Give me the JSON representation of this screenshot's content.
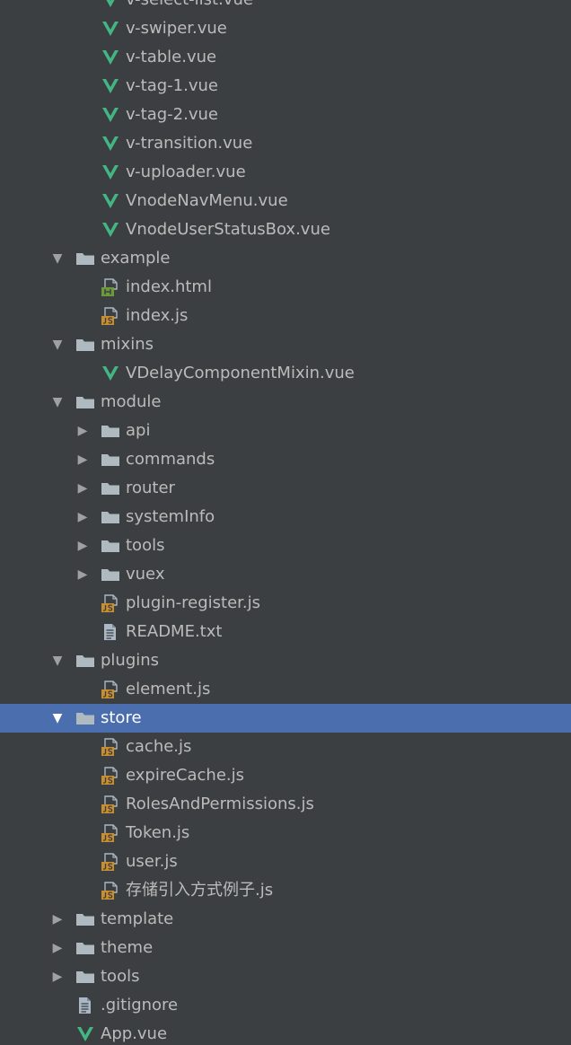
{
  "colors": {
    "background": "#3c3f41",
    "selection": "#4b6eaf",
    "text": "#bbbbbb",
    "text_selected": "#ffffff",
    "vue_green": "#41b883",
    "folder": "#aeb9c0",
    "js_badge": "#c98f2e",
    "html_badge": "#6a9a3a"
  },
  "tree": [
    {
      "label": "v-select-list.vue",
      "depth": 2,
      "icon": "vue-icon"
    },
    {
      "label": "v-swiper.vue",
      "depth": 2,
      "icon": "vue-icon"
    },
    {
      "label": "v-table.vue",
      "depth": 2,
      "icon": "vue-icon"
    },
    {
      "label": "v-tag-1.vue",
      "depth": 2,
      "icon": "vue-icon"
    },
    {
      "label": "v-tag-2.vue",
      "depth": 2,
      "icon": "vue-icon"
    },
    {
      "label": "v-transition.vue",
      "depth": 2,
      "icon": "vue-icon"
    },
    {
      "label": "v-uploader.vue",
      "depth": 2,
      "icon": "vue-icon"
    },
    {
      "label": "VnodeNavMenu.vue",
      "depth": 2,
      "icon": "vue-icon"
    },
    {
      "label": "VnodeUserStatusBox.vue",
      "depth": 2,
      "icon": "vue-icon"
    },
    {
      "label": "example",
      "depth": 1,
      "icon": "folder-icon",
      "toggle": "expanded"
    },
    {
      "label": "index.html",
      "depth": 2,
      "icon": "html-file-icon"
    },
    {
      "label": "index.js",
      "depth": 2,
      "icon": "js-file-icon"
    },
    {
      "label": "mixins",
      "depth": 1,
      "icon": "folder-icon",
      "toggle": "expanded"
    },
    {
      "label": "VDelayComponentMixin.vue",
      "depth": 2,
      "icon": "vue-icon"
    },
    {
      "label": "module",
      "depth": 1,
      "icon": "folder-icon",
      "toggle": "expanded"
    },
    {
      "label": "api",
      "depth": 2,
      "icon": "folder-icon",
      "toggle": "collapsed"
    },
    {
      "label": "commands",
      "depth": 2,
      "icon": "folder-icon",
      "toggle": "collapsed"
    },
    {
      "label": "router",
      "depth": 2,
      "icon": "folder-icon",
      "toggle": "collapsed"
    },
    {
      "label": "systemInfo",
      "depth": 2,
      "icon": "folder-icon",
      "toggle": "collapsed"
    },
    {
      "label": "tools",
      "depth": 2,
      "icon": "folder-icon",
      "toggle": "collapsed"
    },
    {
      "label": "vuex",
      "depth": 2,
      "icon": "folder-icon",
      "toggle": "collapsed"
    },
    {
      "label": "plugin-register.js",
      "depth": 2,
      "icon": "js-file-icon"
    },
    {
      "label": "README.txt",
      "depth": 2,
      "icon": "text-file-icon"
    },
    {
      "label": "plugins",
      "depth": 1,
      "icon": "folder-icon",
      "toggle": "expanded"
    },
    {
      "label": "element.js",
      "depth": 2,
      "icon": "js-file-icon"
    },
    {
      "label": "store",
      "depth": 1,
      "icon": "folder-icon",
      "toggle": "expanded",
      "selected": true
    },
    {
      "label": "cache.js",
      "depth": 2,
      "icon": "js-file-icon"
    },
    {
      "label": "expireCache.js",
      "depth": 2,
      "icon": "js-file-icon"
    },
    {
      "label": "RolesAndPermissions.js",
      "depth": 2,
      "icon": "js-file-icon"
    },
    {
      "label": "Token.js",
      "depth": 2,
      "icon": "js-file-icon"
    },
    {
      "label": "user.js",
      "depth": 2,
      "icon": "js-file-icon"
    },
    {
      "label": "存储引入方式例子.js",
      "depth": 2,
      "icon": "js-file-icon"
    },
    {
      "label": "template",
      "depth": 1,
      "icon": "folder-icon",
      "toggle": "collapsed"
    },
    {
      "label": "theme",
      "depth": 1,
      "icon": "folder-icon",
      "toggle": "collapsed"
    },
    {
      "label": "tools",
      "depth": 1,
      "icon": "folder-icon",
      "toggle": "collapsed"
    },
    {
      "label": ".gitignore",
      "depth": 1,
      "icon": "text-file-icon"
    },
    {
      "label": "App.vue",
      "depth": 1,
      "icon": "vue-icon"
    }
  ]
}
